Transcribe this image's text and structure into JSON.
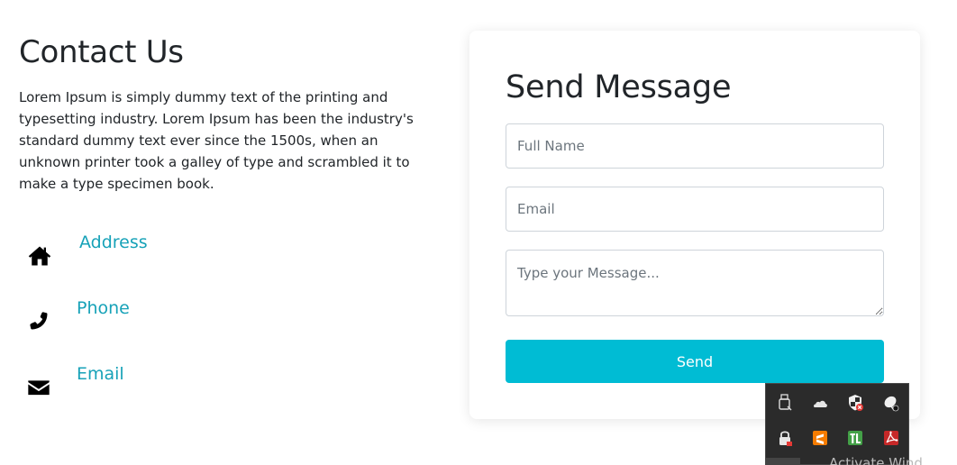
{
  "contact": {
    "title": "Contact Us",
    "description": "Lorem Ipsum is simply dummy text of the printing and typesetting industry. Lorem Ipsum has been the industry's standard dummy text ever since the 1500s, when an unknown printer took a galley of type and scrambled it to make a type specimen book.",
    "items": [
      {
        "label": "Address",
        "icon": "home-icon"
      },
      {
        "label": "Phone",
        "icon": "phone-icon"
      },
      {
        "label": "Email",
        "icon": "envelope-icon"
      }
    ],
    "accent_color": "#17a2b8"
  },
  "form": {
    "title": "Send Message",
    "name_placeholder": "Full Name",
    "email_placeholder": "Email",
    "message_placeholder": "Type your Message...",
    "send_label": "Send",
    "button_color": "#00bcd4"
  },
  "tray": {
    "icons": [
      "usb-drive-icon",
      "onedrive-cloud-icon",
      "security-shield-icon",
      "satellite-dish-icon",
      "lock-app-icon",
      "sublime-text-icon",
      "tl-app-icon",
      "acrobat-reader-icon"
    ]
  },
  "watermark": {
    "text": "Activate Wind"
  }
}
